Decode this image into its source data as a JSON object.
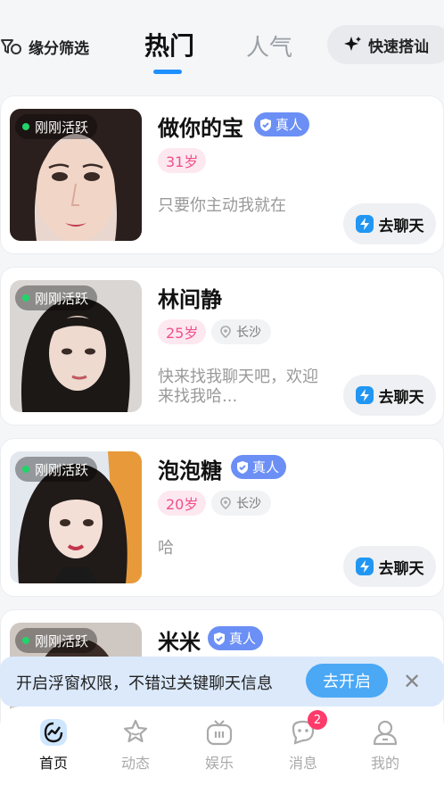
{
  "header": {
    "filter_label": "缘分筛选",
    "tabs": [
      {
        "label": "热门",
        "active": true
      },
      {
        "label": "人气",
        "active": false
      }
    ],
    "quick_match_label": "快速搭讪"
  },
  "cards": [
    {
      "status": "刚刚活跃",
      "name": "做你的宝",
      "verified": "真人",
      "age": "31岁",
      "city": "",
      "bio": "只要你主动我就在",
      "chat_label": "去聊天"
    },
    {
      "status": "刚刚活跃",
      "name": "林间静",
      "verified": "",
      "age": "25岁",
      "city": "长沙",
      "bio": "快来找我聊天吧，欢迎来找我哈...",
      "chat_label": "去聊天"
    },
    {
      "status": "刚刚活跃",
      "name": "泡泡糖",
      "verified": "真人",
      "age": "20岁",
      "city": "长沙",
      "bio": "哈",
      "chat_label": "去聊天"
    },
    {
      "status": "刚刚活跃",
      "name": "米米",
      "verified": "真人",
      "age": "",
      "city": "",
      "bio": "",
      "chat_label": ""
    }
  ],
  "banner": {
    "text": "开启浮窗权限，不错过关键聊天信息",
    "button_label": "去开启",
    "close_icon": "close-icon"
  },
  "bottom_nav": {
    "items": [
      {
        "label": "首页",
        "icon": "home-icon",
        "active": true
      },
      {
        "label": "动态",
        "icon": "star-icon",
        "active": false
      },
      {
        "label": "娱乐",
        "icon": "tv-icon",
        "active": false
      },
      {
        "label": "消息",
        "icon": "message-icon",
        "active": false,
        "badge": "2"
      },
      {
        "label": "我的",
        "icon": "profile-icon",
        "active": false
      }
    ]
  },
  "colors": {
    "accent": "#1e90ff",
    "online_dot": "#22d46a",
    "verified_badge": "#6b8ff5",
    "age_text": "#f0508a",
    "badge_red": "#ff3b6a"
  }
}
